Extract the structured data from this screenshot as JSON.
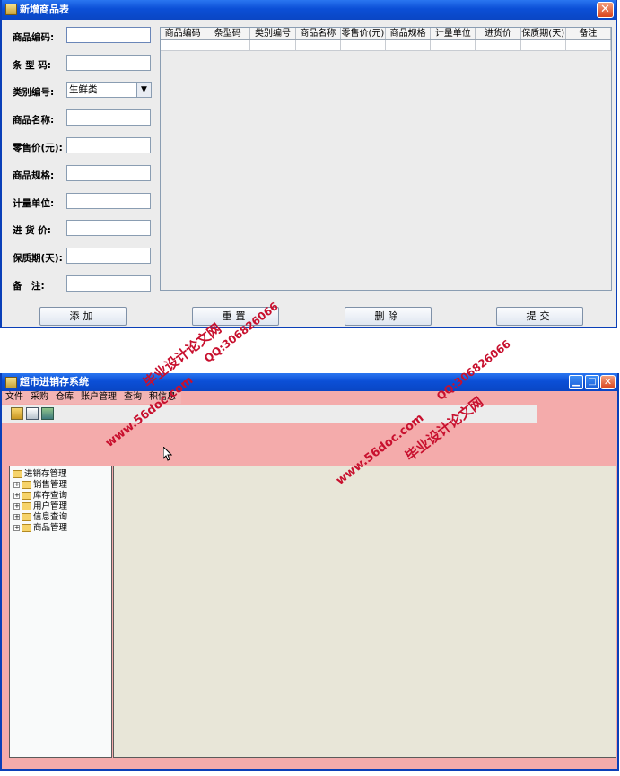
{
  "add_product_window": {
    "title": "新增商品表",
    "close_glyph": "✕",
    "fields": [
      {
        "label": "商品编码:",
        "value": ""
      },
      {
        "label": "条 型 码:",
        "value": ""
      },
      {
        "label": "类别编号:",
        "value": "生鲜类"
      },
      {
        "label": "商品名称:",
        "value": ""
      },
      {
        "label": "零售价(元):",
        "value": ""
      },
      {
        "label": "商品规格:",
        "value": ""
      },
      {
        "label": "计量单位:",
        "value": ""
      },
      {
        "label": "进 货 价:",
        "value": ""
      },
      {
        "label": "保质期(天):",
        "value": ""
      },
      {
        "label": "备　注:",
        "value": ""
      }
    ],
    "table_columns": [
      "商品编码",
      "条型码",
      "类别编号",
      "商品名称",
      "零售价(元)",
      "商品规格",
      "计量单位",
      "进货价",
      "保质期(天)",
      "备注"
    ],
    "buttons": {
      "add": "添加",
      "reset": "重置",
      "delete": "删除",
      "submit": "提交"
    }
  },
  "main_window": {
    "title": "超市进销存系统",
    "menus": [
      "文件",
      "采购",
      "仓库",
      "账户管理",
      "查询",
      "积信息"
    ],
    "tree": {
      "root": "进销存管理",
      "children": [
        "销售管理",
        "库存查询",
        "用户管理",
        "信息查询",
        "商品管理"
      ]
    }
  },
  "watermarks": {
    "site": "www.56doc.com",
    "name": "毕业设计论文网",
    "qq": "QQ:306826066"
  },
  "colors": {
    "titlebar": "#0b4fd6",
    "main_background": "#f4abab",
    "watermark": "#c8102e"
  }
}
